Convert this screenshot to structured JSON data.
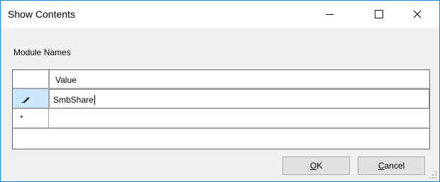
{
  "window": {
    "title": "Show Contents"
  },
  "form": {
    "label": "Module Names"
  },
  "grid": {
    "column_header": "Value",
    "rows": [
      {
        "indicator": "pencil-icon",
        "value": "SmbShare"
      },
      {
        "indicator": "new-row-star",
        "value": ""
      }
    ]
  },
  "buttons": {
    "ok_label": "OK",
    "cancel_label": "Cancel"
  },
  "colors": {
    "accent_border": "#1883d7",
    "selection": "#cce8ff"
  }
}
